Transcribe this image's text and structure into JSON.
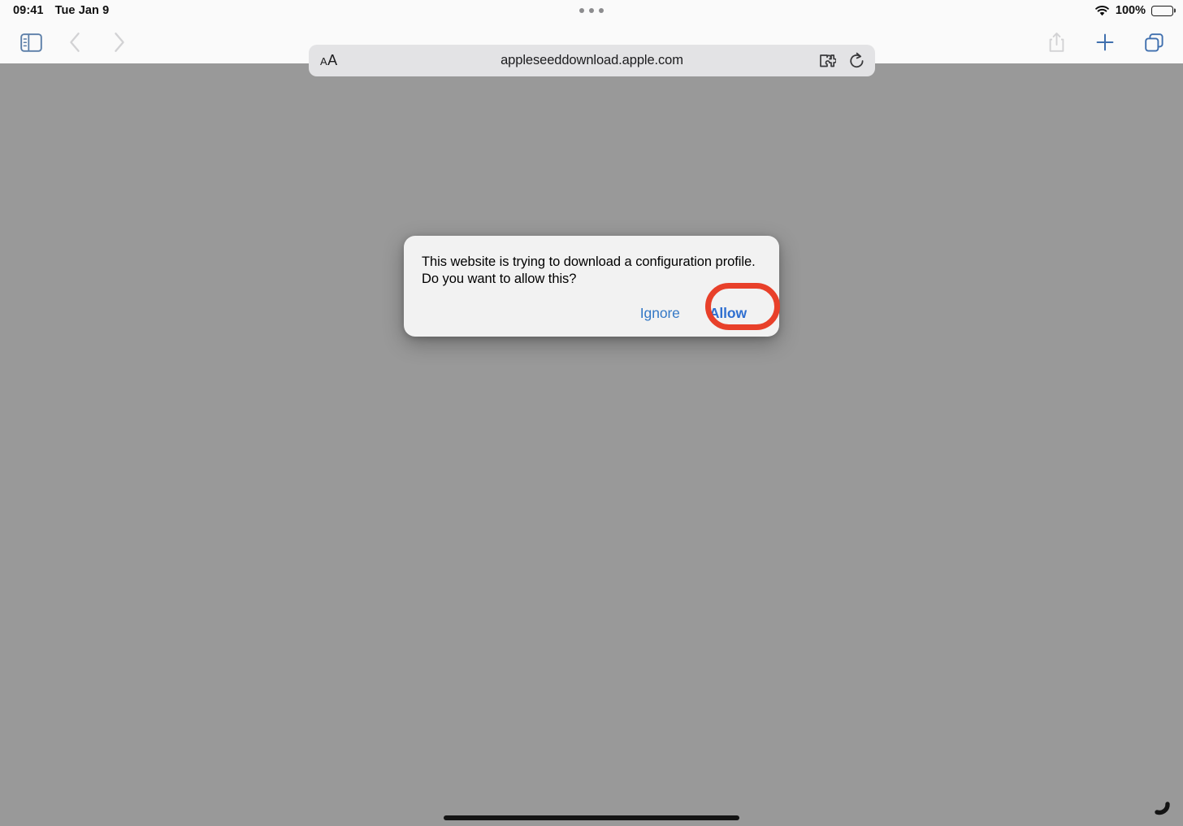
{
  "status_bar": {
    "time": "09:41",
    "date": "Tue Jan 9",
    "battery_percent": "100%",
    "wifi_icon": "wifi-icon",
    "battery_icon": "battery-full-icon",
    "multitasking_icon": "multitasking-dots-icon"
  },
  "toolbar": {
    "sidebar_icon": "sidebar-toggle-icon",
    "back_icon": "chevron-left-icon",
    "forward_icon": "chevron-right-icon",
    "text_size_small": "A",
    "text_size_large": "A",
    "url": "appleseeddownload.apple.com",
    "extensions_icon": "puzzle-piece-icon",
    "reload_icon": "reload-icon",
    "share_icon": "share-icon",
    "new_tab_icon": "plus-icon",
    "tabs_icon": "tabs-overview-icon"
  },
  "dialog": {
    "message": "This website is trying to download a configuration profile. Do you want to allow this?",
    "ignore_label": "Ignore",
    "allow_label": "Allow"
  },
  "annotation": {
    "target": "allow-button",
    "color": "#E8402A"
  },
  "colors": {
    "page_background": "#999999",
    "toolbar_background": "#FAFAFA",
    "address_field": "#E3E3E5",
    "dialog_background": "#F2F2F2",
    "link_blue": "#3478C6",
    "highlight": "#E8402A"
  }
}
